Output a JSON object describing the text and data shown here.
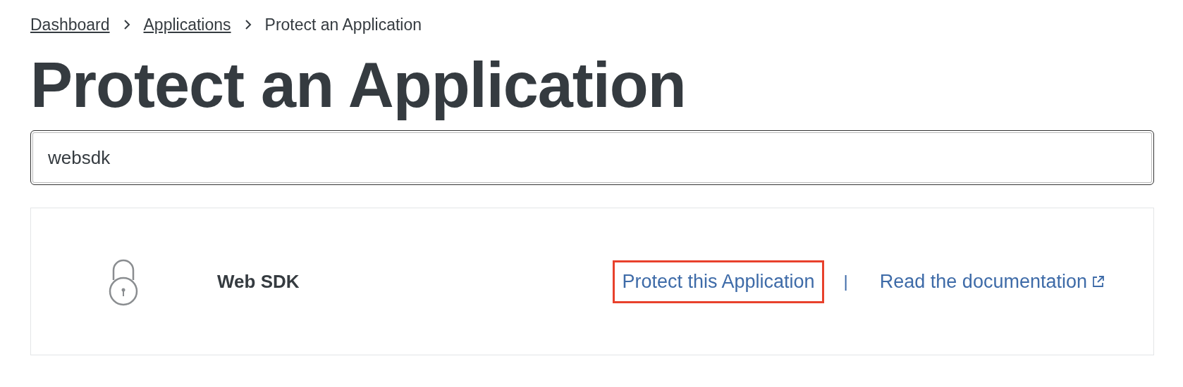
{
  "breadcrumb": [
    {
      "label": "Dashboard",
      "link": true
    },
    {
      "label": "Applications",
      "link": true
    },
    {
      "label": "Protect an Application",
      "link": false
    }
  ],
  "title": "Protect an Application",
  "search": {
    "value": "websdk"
  },
  "results": [
    {
      "name": "Web SDK",
      "actions": [
        {
          "label": "Protect this Application",
          "highlighted": true,
          "external": false
        },
        {
          "label": "Read the documentation",
          "highlighted": false,
          "external": true
        }
      ],
      "separator": "|"
    }
  ]
}
